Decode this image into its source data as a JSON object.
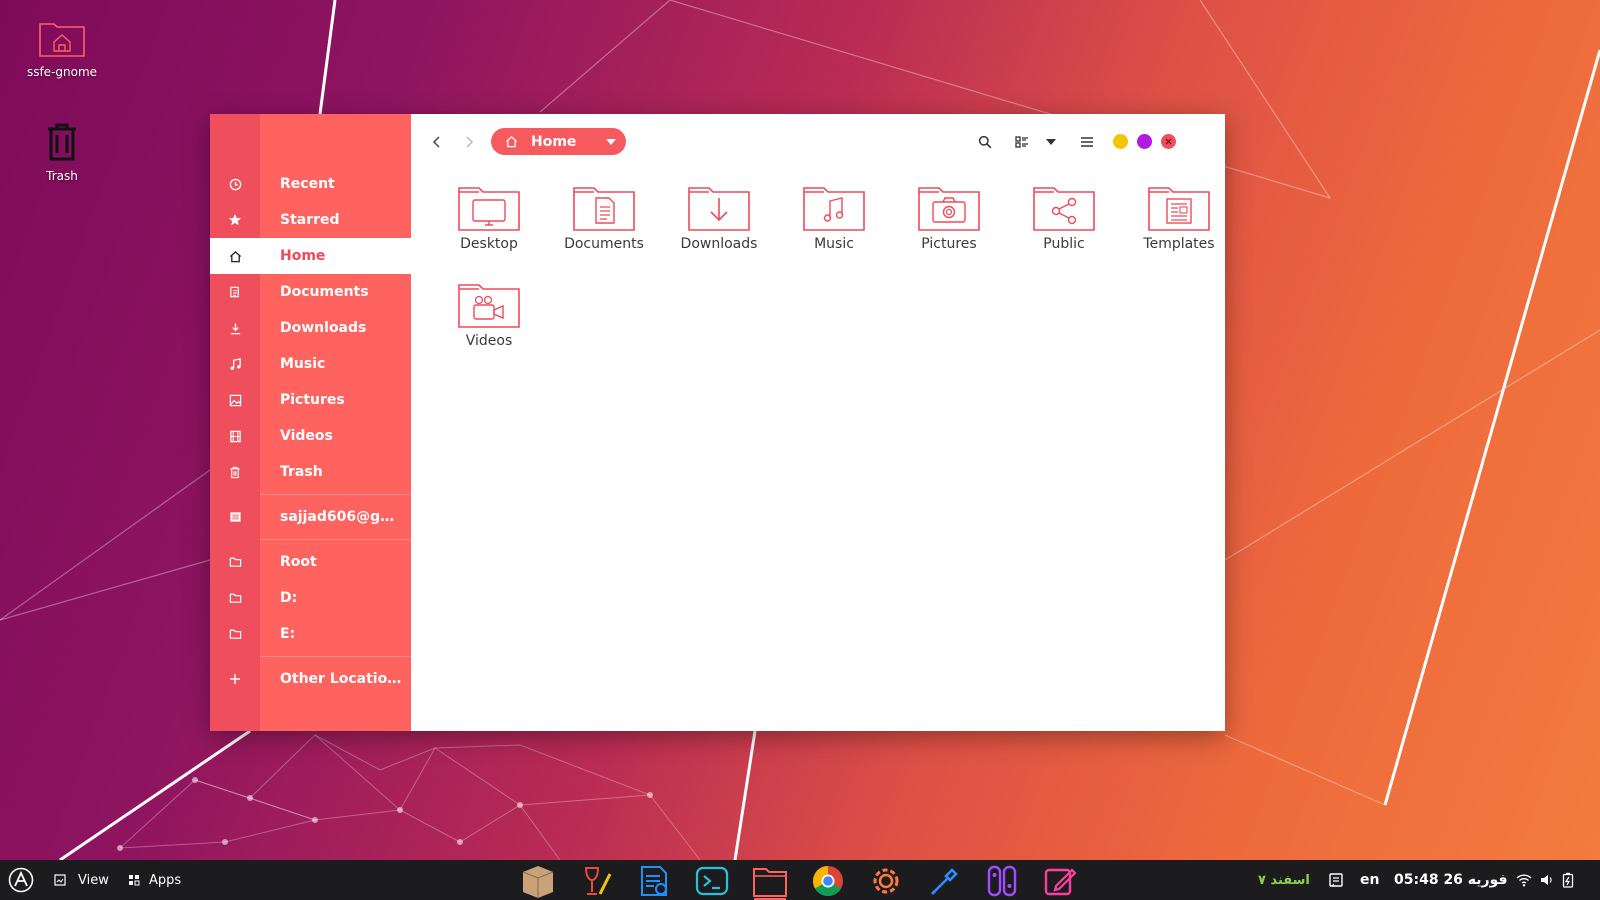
{
  "desktop": {
    "icons": [
      {
        "label": "ssfe-gnome",
        "icon": "home-folder-icon"
      },
      {
        "label": "Trash",
        "icon": "trash-icon"
      }
    ]
  },
  "toolbar": {
    "path_label": "Home",
    "back_icon": "chevron-left-icon",
    "forward_icon": "chevron-right-icon",
    "search_icon": "search-icon",
    "view_icon": "list-view-icon",
    "menu_icon": "hamburger-menu-icon",
    "window_controls": {
      "minimize_color": "#f5c400",
      "maximize_color": "#b01be0",
      "close_color": "#ef4f5c"
    }
  },
  "sidebar": {
    "items": [
      {
        "label": "Recent",
        "icon": "clock-icon"
      },
      {
        "label": "Starred",
        "icon": "star-icon"
      },
      {
        "label": "Home",
        "icon": "home-icon",
        "active": true
      },
      {
        "label": "Documents",
        "icon": "document-icon"
      },
      {
        "label": "Downloads",
        "icon": "download-icon"
      },
      {
        "label": "Music",
        "icon": "music-icon"
      },
      {
        "label": "Pictures",
        "icon": "picture-icon"
      },
      {
        "label": "Videos",
        "icon": "film-icon"
      },
      {
        "label": "Trash",
        "icon": "trash-icon"
      }
    ],
    "account": {
      "label": "sajjad606@gm...",
      "icon": "network-drive-icon"
    },
    "drives": [
      {
        "label": "Root",
        "icon": "folder-icon"
      },
      {
        "label": "D:",
        "icon": "folder-icon"
      },
      {
        "label": "E:",
        "icon": "folder-icon"
      }
    ],
    "other": {
      "label": "Other Locations",
      "icon": "plus-icon"
    }
  },
  "files": [
    {
      "name": "Desktop",
      "icon": "desktop-folder-icon"
    },
    {
      "name": "Documents",
      "icon": "documents-folder-icon"
    },
    {
      "name": "Downloads",
      "icon": "downloads-folder-icon"
    },
    {
      "name": "Music",
      "icon": "music-folder-icon"
    },
    {
      "name": "Pictures",
      "icon": "pictures-folder-icon"
    },
    {
      "name": "Public",
      "icon": "public-folder-icon"
    },
    {
      "name": "Templates",
      "icon": "templates-folder-icon"
    },
    {
      "name": "Videos",
      "icon": "videos-folder-icon"
    }
  ],
  "taskbar": {
    "view_label": "View",
    "apps_label": "Apps",
    "date_persian": "۷ اسفند",
    "keyboard_layout": "en",
    "clock": "05:48  26 فوریه",
    "dock": [
      {
        "name": "archive-app-icon"
      },
      {
        "name": "wine-app-icon"
      },
      {
        "name": "text-editor-app-icon"
      },
      {
        "name": "terminal-app-icon"
      },
      {
        "name": "files-app-icon",
        "running": true
      },
      {
        "name": "chrome-dev-app-icon"
      },
      {
        "name": "settings-app-icon"
      },
      {
        "name": "color-picker-app-icon"
      },
      {
        "name": "switch-app-icon"
      },
      {
        "name": "drawing-app-icon"
      }
    ]
  },
  "colors": {
    "accent": "#ff6360",
    "sidebar_stripe": "#ef4f5c",
    "folder_stroke": "#ee4a5a"
  }
}
